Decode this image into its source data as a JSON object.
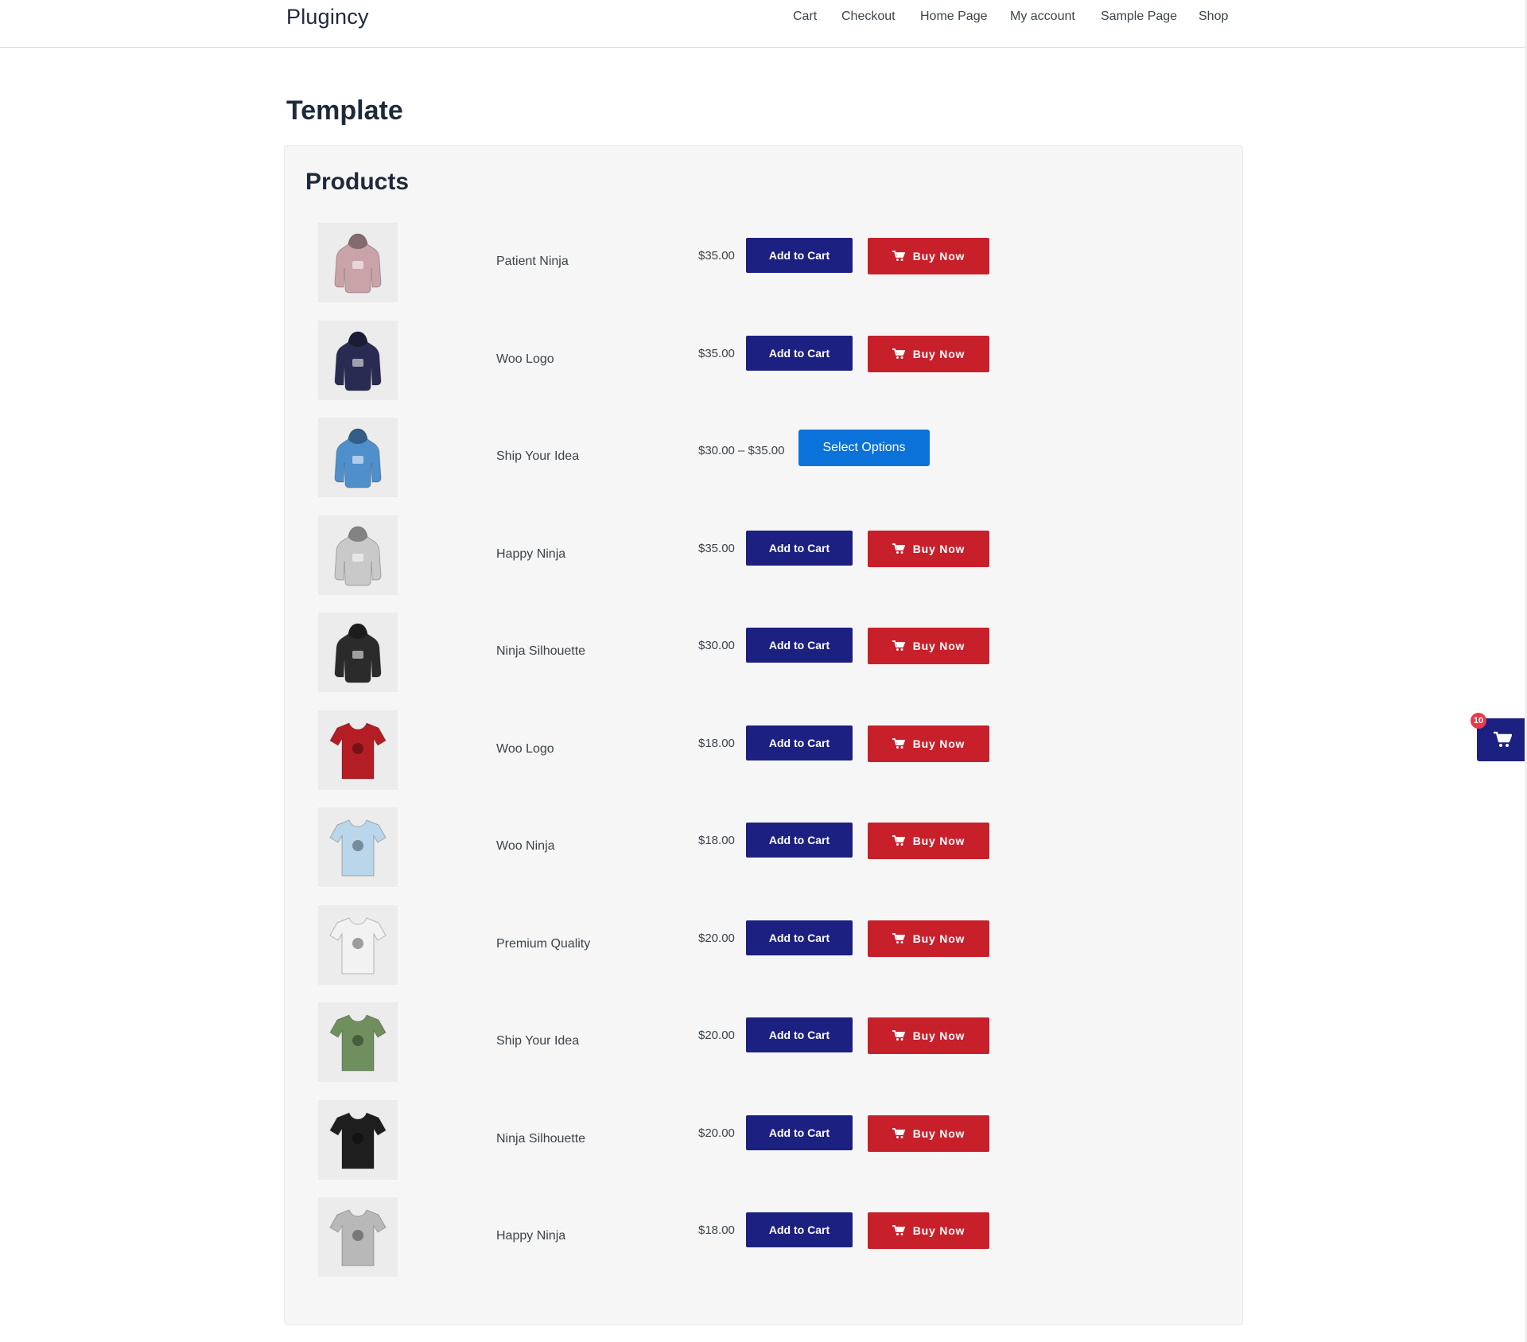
{
  "site": {
    "title": "Plugincy"
  },
  "nav": [
    {
      "label": "Cart"
    },
    {
      "label": "Checkout"
    },
    {
      "label": "Home Page"
    },
    {
      "label": "My account"
    },
    {
      "label": "Sample Page"
    },
    {
      "label": "Shop"
    }
  ],
  "page": {
    "title": "Template"
  },
  "panel": {
    "title": "Products"
  },
  "labels": {
    "add_to_cart": "Add to Cart",
    "buy_now": "Buy Now",
    "select_options": "Select Options"
  },
  "floating_cart": {
    "count": "10",
    "icon": "cart-icon"
  },
  "products": [
    {
      "name": "Patient Ninja",
      "price": "$35.00",
      "kind": "hoodie",
      "color": "#c9a3a8",
      "action": "buy"
    },
    {
      "name": "Woo Logo",
      "price": "$35.00",
      "kind": "hoodie",
      "color": "#2a2b52",
      "action": "buy"
    },
    {
      "name": "Ship Your Idea",
      "price": "$30.00 – $35.00",
      "kind": "hoodie",
      "color": "#4f8fcc",
      "action": "select"
    },
    {
      "name": "Happy Ninja",
      "price": "$35.00",
      "kind": "hoodie",
      "color": "#c9c9c9",
      "action": "buy"
    },
    {
      "name": "Ninja Silhouette",
      "price": "$30.00",
      "kind": "hoodie",
      "color": "#2b2b2b",
      "action": "buy"
    },
    {
      "name": "Woo Logo",
      "price": "$18.00",
      "kind": "tshirt",
      "color": "#b51d24",
      "action": "buy"
    },
    {
      "name": "Woo Ninja",
      "price": "$18.00",
      "kind": "tshirt",
      "color": "#b9d6ea",
      "action": "buy"
    },
    {
      "name": "Premium Quality",
      "price": "$20.00",
      "kind": "tshirt",
      "color": "#f2f2f2",
      "action": "buy"
    },
    {
      "name": "Ship Your Idea",
      "price": "$20.00",
      "kind": "tshirt",
      "color": "#6f8f5e",
      "action": "buy"
    },
    {
      "name": "Ninja Silhouette",
      "price": "$20.00",
      "kind": "tshirt",
      "color": "#1e1e1e",
      "action": "buy"
    },
    {
      "name": "Happy Ninja",
      "price": "$18.00",
      "kind": "tshirt",
      "color": "#b8b8b8",
      "action": "buy"
    }
  ]
}
